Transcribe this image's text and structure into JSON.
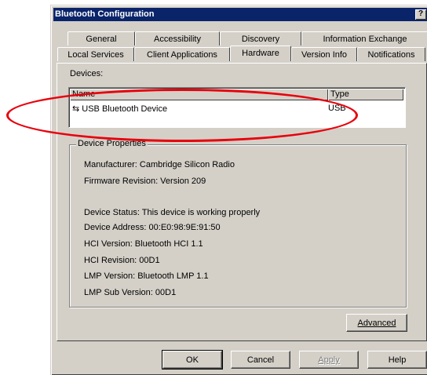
{
  "window": {
    "title": "Bluetooth Configuration",
    "help_glyph": "?",
    "close_glyph": "✕"
  },
  "tabs_back": [
    "General",
    "Accessibility",
    "Discovery",
    "Information Exchange"
  ],
  "tabs_front": [
    "Local Services",
    "Client Applications",
    "Hardware",
    "Version Info",
    "Notifications"
  ],
  "active_tab": "Hardware",
  "devices": {
    "label": "Devices:",
    "columns": [
      "Name",
      "Type"
    ],
    "rows": [
      {
        "name": "USB Bluetooth Device",
        "type": "USB",
        "icon": "usb-icon"
      }
    ]
  },
  "properties": {
    "title": "Device Properties",
    "manufacturer": "Manufacturer:    Cambridge Silicon Radio",
    "firmware": "Firmware Revision:   Version 209",
    "status": "Device Status:  This device is working properly",
    "address": "Device Address:   00:E0:98:9E:91:50",
    "hci_version": "HCI Version:   Bluetooth HCI 1.1",
    "hci_revision": "HCI Revision:   00D1",
    "lmp_version": "LMP Version:   Bluetooth LMP 1.1",
    "lmp_sub_version": "LMP Sub Version:   00D1",
    "advanced_label": "Advanced"
  },
  "buttons": {
    "ok": "OK",
    "cancel": "Cancel",
    "apply": "Apply",
    "help": "Help"
  },
  "colors": {
    "titlebar": "#0a246a",
    "dialog": "#d4d0c8",
    "annotation": "#e8000c"
  }
}
